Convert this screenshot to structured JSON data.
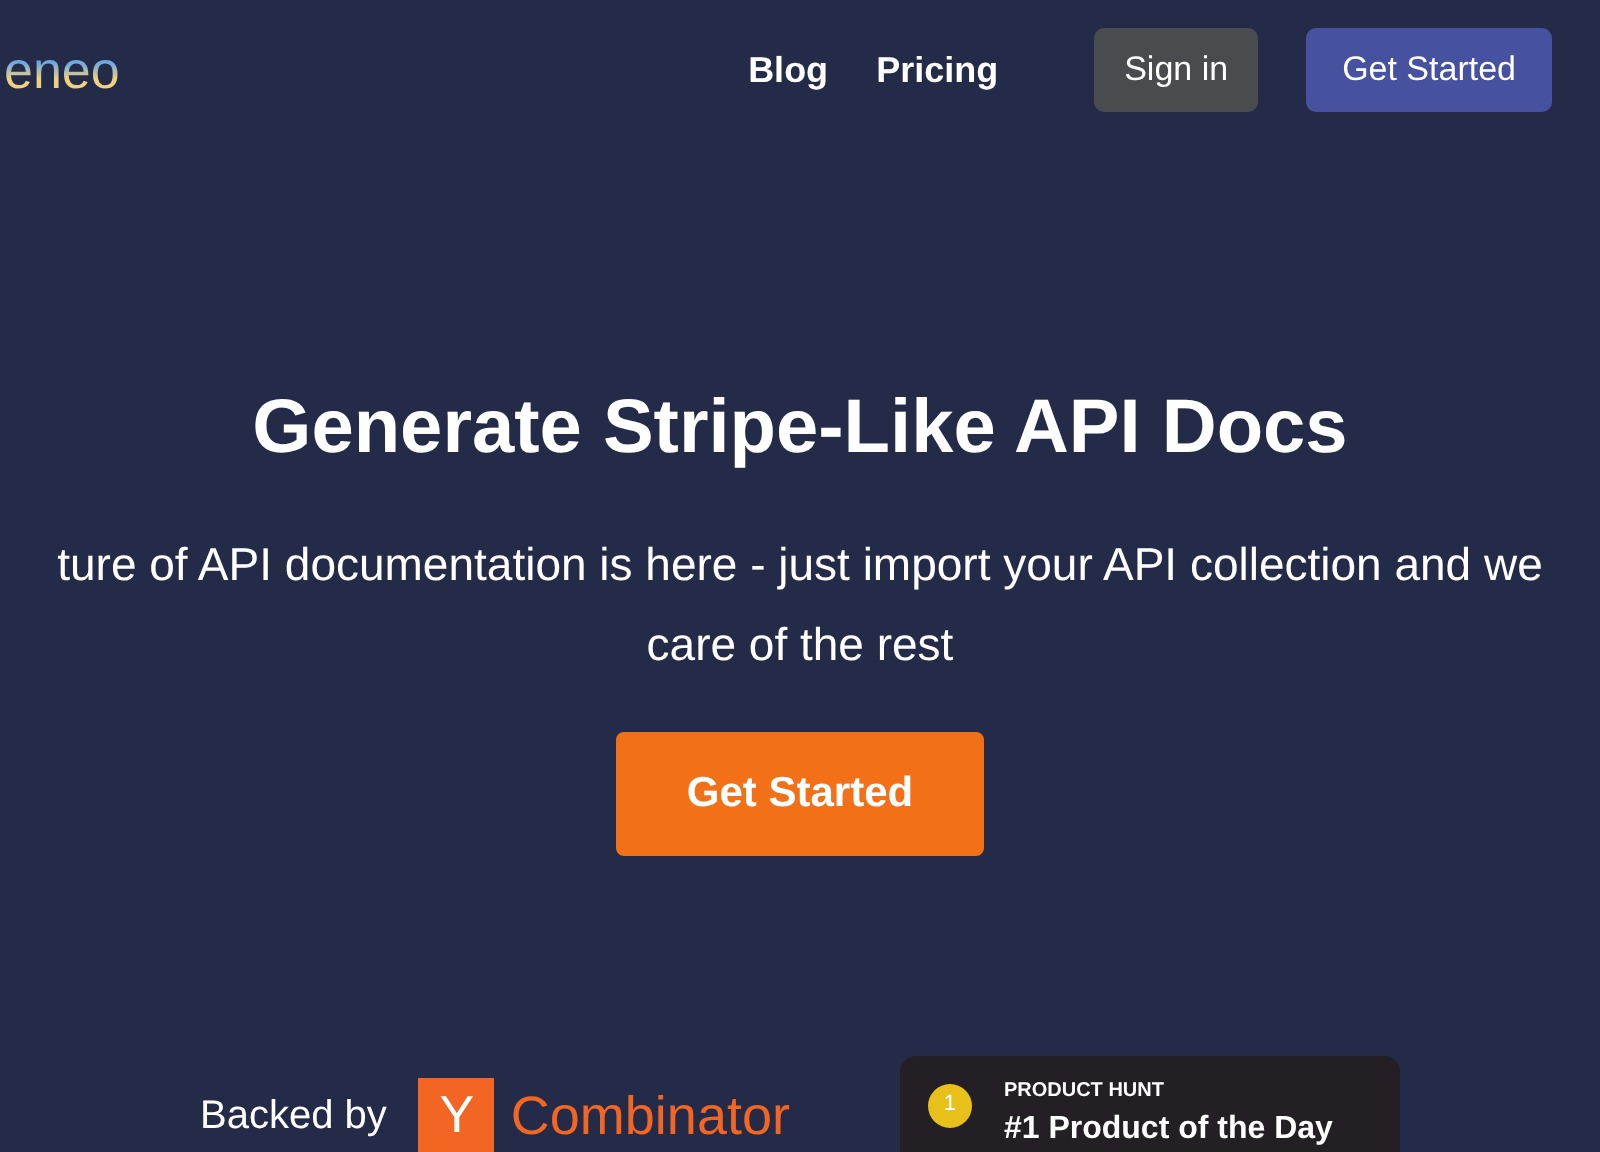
{
  "logo": "eneo",
  "nav": {
    "links": [
      "Blog",
      "Pricing"
    ],
    "sign_in": "Sign in",
    "get_started": "Get Started"
  },
  "hero": {
    "title": "Generate Stripe-Like API Docs",
    "subtitle_lines": [
      "ture of API documentation is here - just import your API collection and we",
      "care of the rest"
    ],
    "cta": "Get Started"
  },
  "backed": {
    "label": "Backed by",
    "yc_letter": "Y",
    "yc_name": "Combinator"
  },
  "product_hunt": {
    "medal": "1",
    "eyebrow": "PRODUCT HUNT",
    "title": "#1 Product of the Day"
  }
}
